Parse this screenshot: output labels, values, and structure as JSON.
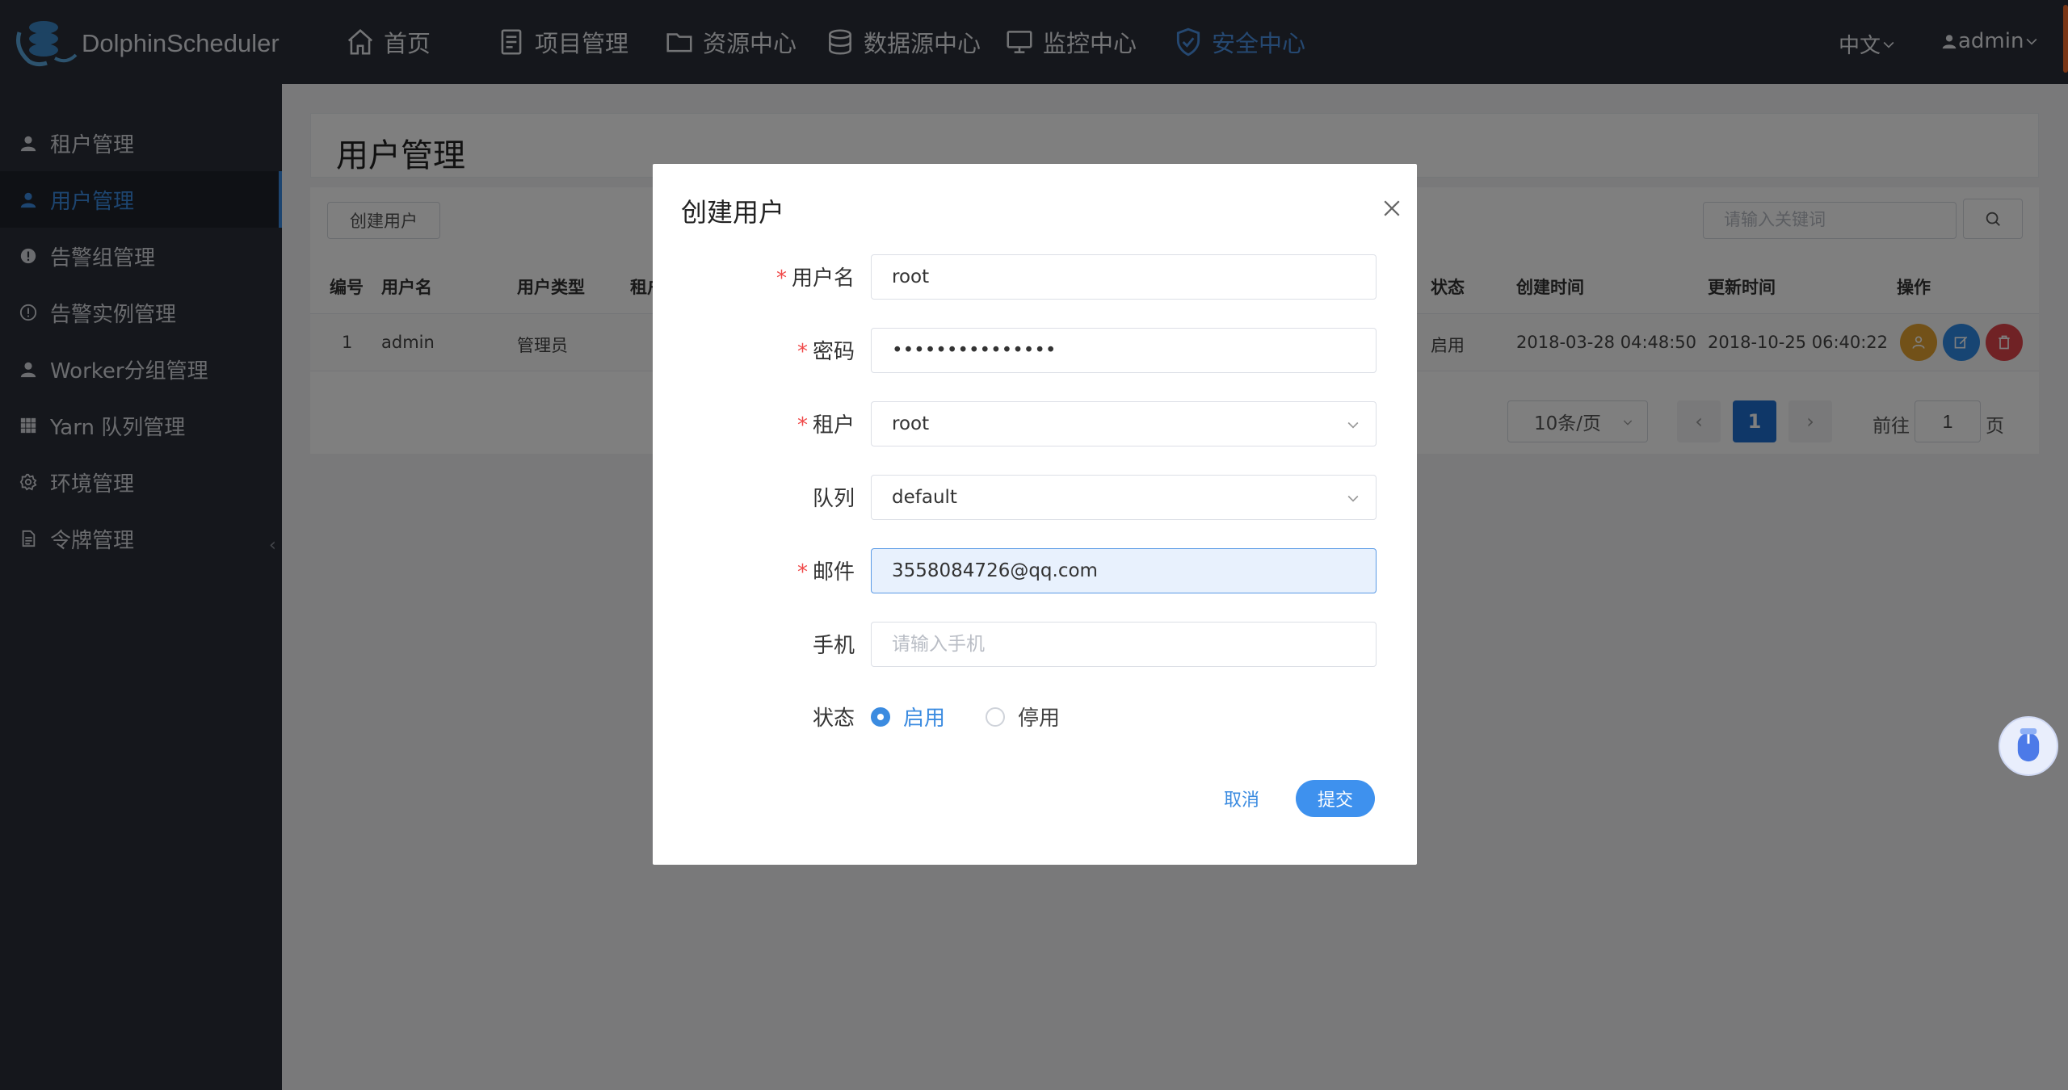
{
  "app": {
    "brand": "DolphinScheduler"
  },
  "nav": [
    {
      "label": "首页",
      "icon": "home-icon"
    },
    {
      "label": "项目管理",
      "icon": "document-icon"
    },
    {
      "label": "资源中心",
      "icon": "folder-icon"
    },
    {
      "label": "数据源中心",
      "icon": "database-icon"
    },
    {
      "label": "监控中心",
      "icon": "monitor-icon"
    },
    {
      "label": "安全中心",
      "icon": "shield-icon",
      "active": true
    }
  ],
  "top_right": {
    "language": "中文",
    "user": "admin"
  },
  "sidebar": {
    "items": [
      {
        "label": "租户管理",
        "icon": "user-icon"
      },
      {
        "label": "用户管理",
        "icon": "user-icon",
        "active": true
      },
      {
        "label": "告警组管理",
        "icon": "alert-icon"
      },
      {
        "label": "告警实例管理",
        "icon": "info-icon"
      },
      {
        "label": "Worker分组管理",
        "icon": "user-icon"
      },
      {
        "label": "Yarn 队列管理",
        "icon": "grid-icon"
      },
      {
        "label": "环境管理",
        "icon": "gear-icon"
      },
      {
        "label": "令牌管理",
        "icon": "document-icon"
      }
    ]
  },
  "page": {
    "title": "用户管理",
    "create_button": "创建用户",
    "search_placeholder": "请输入关键词"
  },
  "table": {
    "headers": [
      "编号",
      "用户名",
      "用户类型",
      "租户",
      "状态",
      "创建时间",
      "更新时间",
      "操作"
    ],
    "rows": [
      {
        "id": "1",
        "username": "admin",
        "type": "管理员",
        "status": "启用",
        "created": "2018-03-28 04:48:50",
        "updated": "2018-10-25 06:40:22"
      }
    ]
  },
  "pagination": {
    "page_size": "10条/页",
    "current": "1",
    "goto_prefix": "前往",
    "goto_value": "1",
    "goto_suffix": "页"
  },
  "modal": {
    "title": "创建用户",
    "fields": {
      "username": {
        "label": "用户名",
        "value": "root",
        "required": true
      },
      "password": {
        "label": "密码",
        "value": "•••••••••••••••",
        "required": true
      },
      "tenant": {
        "label": "租户",
        "value": "root",
        "required": true
      },
      "queue": {
        "label": "队列",
        "value": "default",
        "required": false
      },
      "email": {
        "label": "邮件",
        "value": "3558084726@qq.com",
        "required": true
      },
      "phone": {
        "label": "手机",
        "value": "",
        "placeholder": "请输入手机",
        "required": false
      },
      "status": {
        "label": "状态",
        "options": [
          "启用",
          "停用"
        ],
        "selected": "启用"
      }
    },
    "cancel": "取消",
    "submit": "提交"
  },
  "colors": {
    "topbar": "#2b2f38",
    "accent": "#3b8be0",
    "required": "#f04a4a",
    "submit": "#3e91ee",
    "op_user": "#e5a330",
    "op_edit": "#2f8be6",
    "op_delete": "#e0444b"
  }
}
